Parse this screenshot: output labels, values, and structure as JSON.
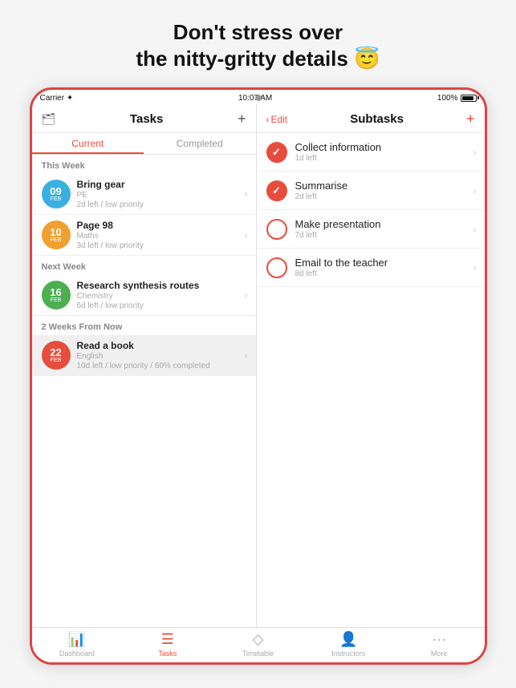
{
  "headline": "Don't stress over\nthe nitty-gritty details 😇",
  "statusBar": {
    "carrier": "Carrier ✦",
    "time": "10:07 AM",
    "battery": "100%"
  },
  "leftPanel": {
    "title": "Tasks",
    "tabs": [
      "Current",
      "Completed"
    ],
    "activeTab": 0,
    "sections": [
      {
        "label": "This Week",
        "tasks": [
          {
            "day": "09",
            "month": "Feb",
            "color": "#3ab0e0",
            "name": "Bring gear",
            "subject": "PE",
            "detail": "2d left / low priority"
          },
          {
            "day": "10",
            "month": "Feb",
            "color": "#f0a030",
            "name": "Page 98",
            "subject": "Maths",
            "detail": "3d left / low priority"
          }
        ]
      },
      {
        "label": "Next Week",
        "tasks": [
          {
            "day": "16",
            "month": "Feb",
            "color": "#4caf50",
            "name": "Research synthesis routes",
            "subject": "Chemistry",
            "detail": "6d left / low priority"
          }
        ]
      },
      {
        "label": "2 Weeks From Now",
        "tasks": [
          {
            "day": "22",
            "month": "Feb",
            "color": "#e74c3c",
            "name": "Read a book",
            "subject": "English",
            "detail": "10d left / low priority / 60% completed",
            "selected": true
          }
        ]
      }
    ]
  },
  "rightPanel": {
    "backLabel": "Edit",
    "title": "Subtasks",
    "subtasks": [
      {
        "name": "Collect information",
        "detail": "1d left",
        "checked": true
      },
      {
        "name": "Summarise",
        "detail": "2d left",
        "checked": true
      },
      {
        "name": "Make presentation",
        "detail": "7d left",
        "checked": false
      },
      {
        "name": "Email to the teacher",
        "detail": "8d left",
        "checked": false
      }
    ]
  },
  "bottomNav": {
    "items": [
      {
        "icon": "📊",
        "label": "Dashboard",
        "active": false
      },
      {
        "icon": "☰",
        "label": "Tasks",
        "active": true
      },
      {
        "icon": "◇",
        "label": "Timetable",
        "active": false
      },
      {
        "icon": "👤",
        "label": "Instructors",
        "active": false
      },
      {
        "icon": "···",
        "label": "More",
        "active": false
      }
    ]
  }
}
